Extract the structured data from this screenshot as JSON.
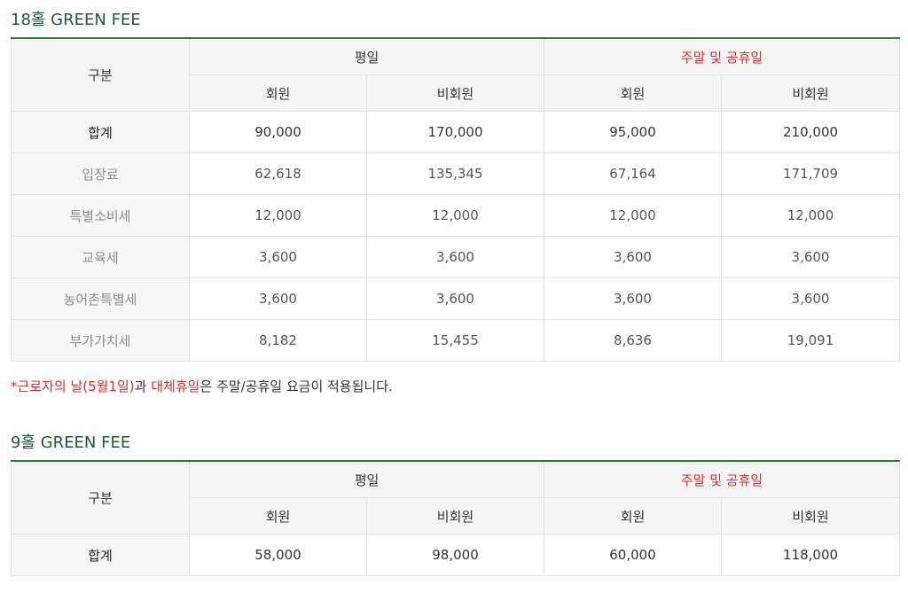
{
  "section18": {
    "title": "18홀 GREEN FEE",
    "head": {
      "category": "구분",
      "weekday": "평일",
      "weekend": "주말 및 공휴일",
      "member": "회원",
      "nonmember": "비회원"
    },
    "rows": [
      {
        "label": "합계",
        "v": [
          "90,000",
          "170,000",
          "95,000",
          "210,000"
        ]
      },
      {
        "label": "입장료",
        "v": [
          "62,618",
          "135,345",
          "67,164",
          "171,709"
        ]
      },
      {
        "label": "특별소비세",
        "v": [
          "12,000",
          "12,000",
          "12,000",
          "12,000"
        ]
      },
      {
        "label": "교육세",
        "v": [
          "3,600",
          "3,600",
          "3,600",
          "3,600"
        ]
      },
      {
        "label": "농어촌특별세",
        "v": [
          "3,600",
          "3,600",
          "3,600",
          "3,600"
        ]
      },
      {
        "label": "부가가치세",
        "v": [
          "8,182",
          "15,455",
          "8,636",
          "19,091"
        ]
      }
    ]
  },
  "note": {
    "asterisk": "*",
    "labor_day": "근로자의 날(5월1일)",
    "and": "과 ",
    "substitute": "대체휴일",
    "rest": "은 주말/공휴일 요금이 적용됩니다.",
    "accent_color": "#e02a2a"
  },
  "section9": {
    "title": "9홀 GREEN FEE",
    "head": {
      "category": "구분",
      "weekday": "평일",
      "weekend": "주말 및 공휴일",
      "member": "회원",
      "nonmember": "비회원"
    },
    "rows": [
      {
        "label": "합계",
        "v": [
          "58,000",
          "98,000",
          "60,000",
          "118,000"
        ]
      }
    ]
  },
  "colors": {
    "title_green": "#1e5a34",
    "border_green": "#2b7d33",
    "weekend_red": "#e02a2a"
  }
}
